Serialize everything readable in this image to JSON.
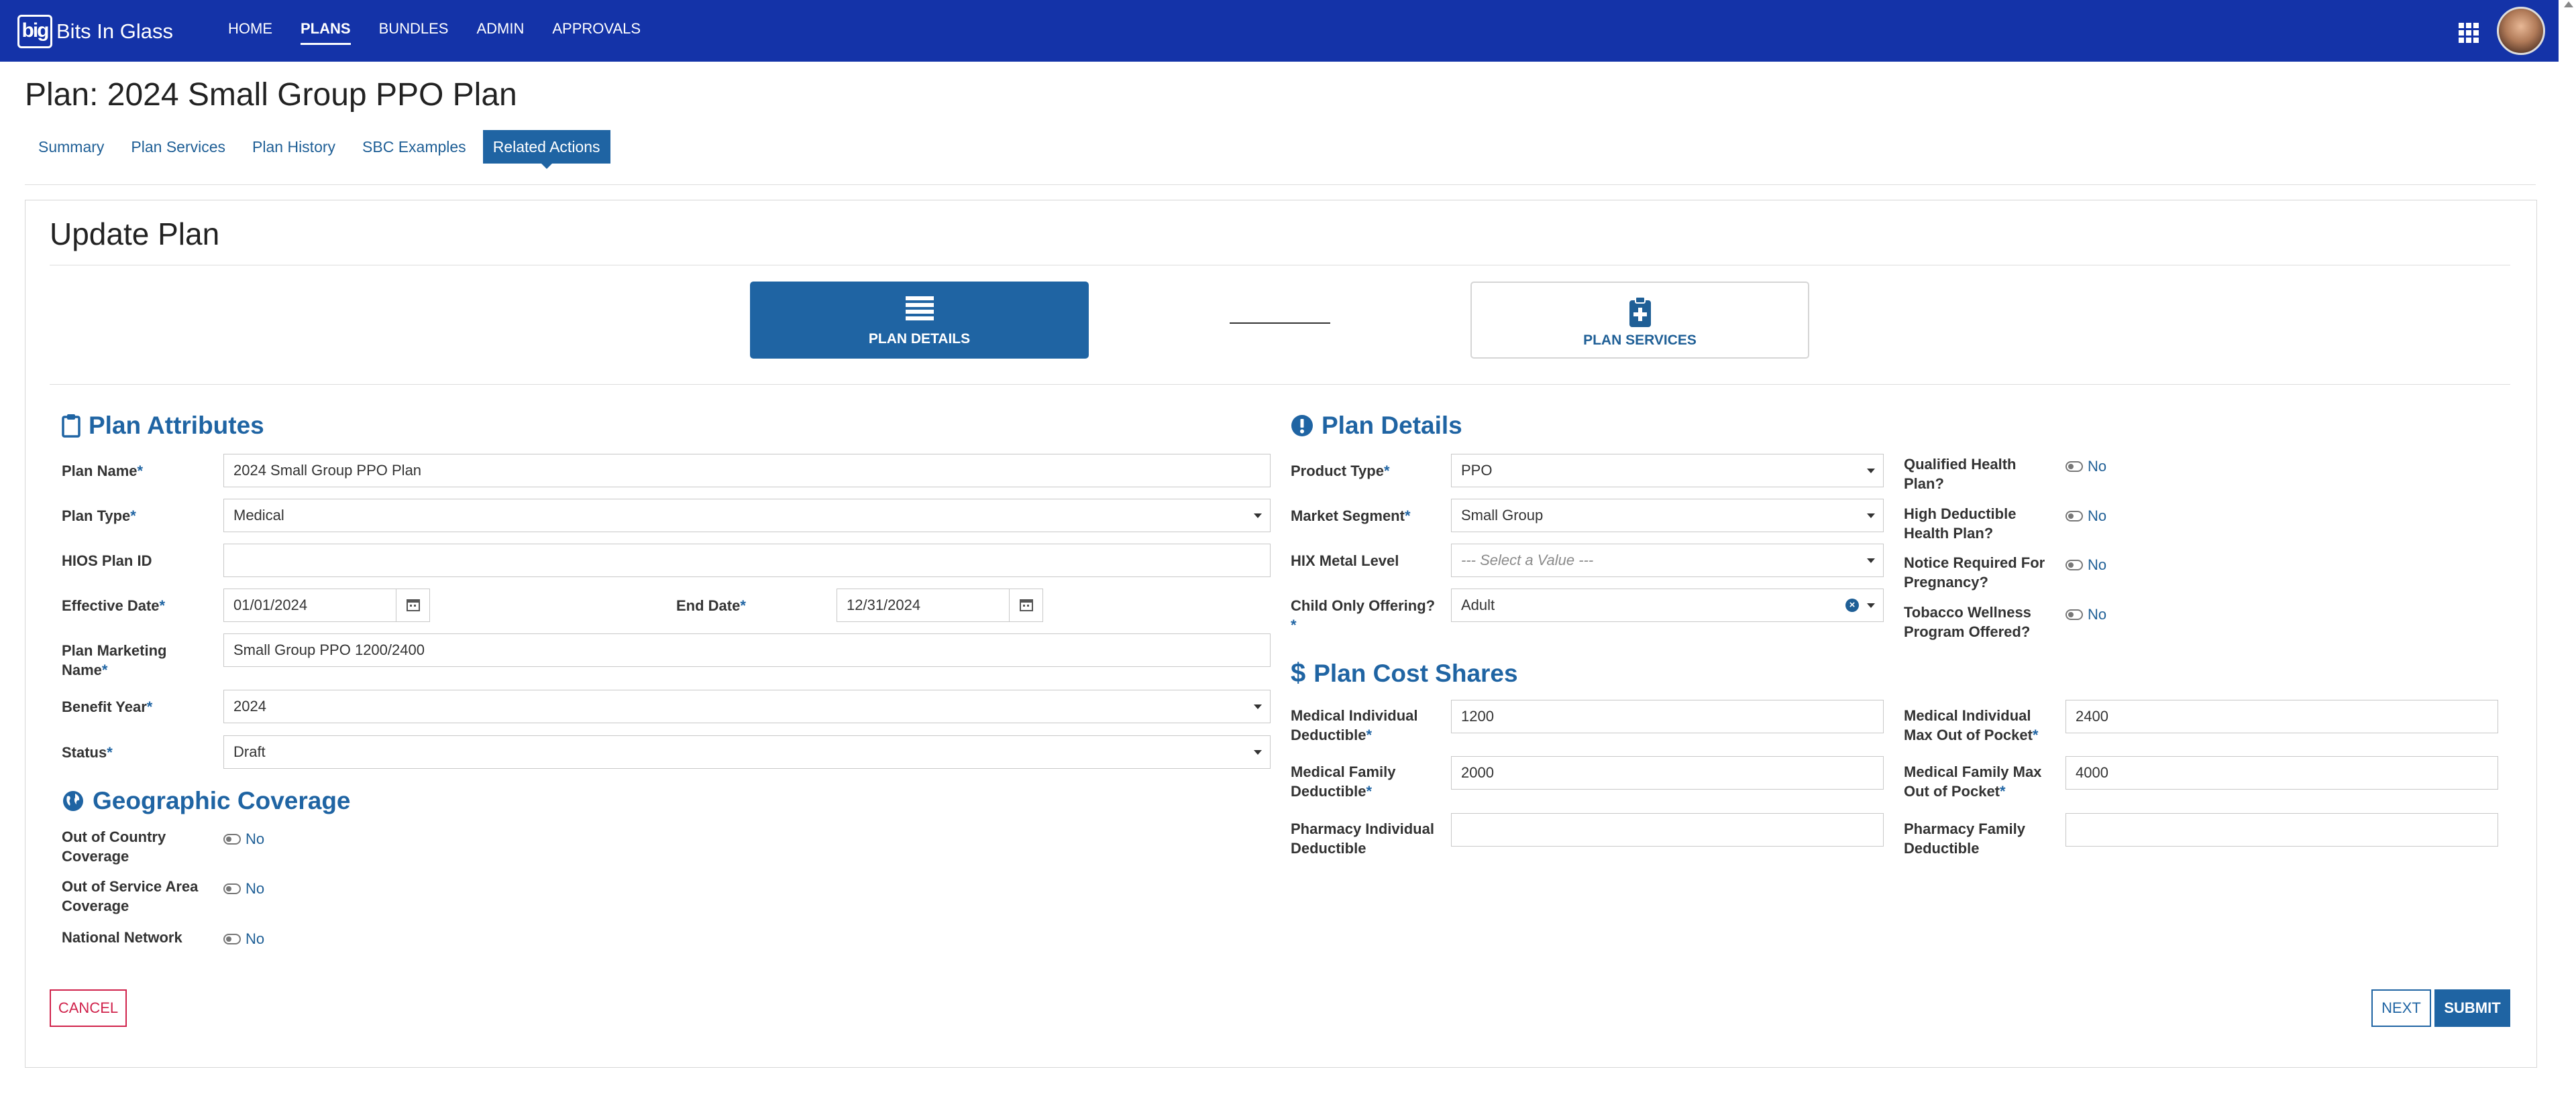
{
  "app": {
    "logo_mark": "big",
    "name": "Bits In Glass",
    "nav": [
      "HOME",
      "PLANS",
      "BUNDLES",
      "ADMIN",
      "APPROVALS"
    ],
    "active_nav": "PLANS"
  },
  "header": {
    "title": "Plan: 2024 Small Group PPO Plan",
    "tabs": [
      "Summary",
      "Plan Services",
      "Plan History",
      "SBC Examples",
      "Related Actions"
    ],
    "active_tab": "Related Actions"
  },
  "form": {
    "title": "Update Plan",
    "steps": [
      {
        "label": "PLAN DETAILS",
        "icon": "list-icon",
        "active": true
      },
      {
        "label": "PLAN SERVICES",
        "icon": "clipboard-plus-icon",
        "active": false
      }
    ]
  },
  "attributes": {
    "title": "Plan Attributes",
    "plan_name_label": "Plan Name",
    "plan_name_value": "2024 Small Group PPO Plan",
    "plan_type_label": "Plan Type",
    "plan_type_value": "Medical",
    "hios_label": "HIOS Plan ID",
    "hios_value": "",
    "effective_date_label": "Effective Date",
    "effective_date_value": "01/01/2024",
    "end_date_label": "End Date",
    "end_date_value": "12/31/2024",
    "marketing_name_label_1": "Plan Marketing",
    "marketing_name_label_2": "Name",
    "marketing_name_value": "Small Group PPO 1200/2400",
    "benefit_year_label": "Benefit Year",
    "benefit_year_value": "2024",
    "status_label": "Status",
    "status_value": "Draft"
  },
  "geo": {
    "title": "Geographic Coverage",
    "out_of_country_1": "Out of Country",
    "out_of_country_2": "Coverage",
    "out_of_country_value": "No",
    "out_of_area_1": "Out of Service Area",
    "out_of_area_2": "Coverage",
    "out_of_area_value": "No",
    "national_network": "National Network",
    "national_network_value": "No"
  },
  "details": {
    "title": "Plan Details",
    "product_type_label": "Product Type",
    "product_type_value": "PPO",
    "market_segment_label": "Market Segment",
    "market_segment_value": "Small Group",
    "hix_metal_label": "HIX Metal Level",
    "hix_metal_placeholder": "--- Select a Value ---",
    "child_only_label": "Child Only Offering?",
    "child_only_value": "Adult",
    "qhp_1": "Qualified Health",
    "qhp_2": "Plan?",
    "qhp_value": "No",
    "hdhp_1": "High Deductible",
    "hdhp_2": "Health Plan?",
    "hdhp_value": "No",
    "notice_1": "Notice Required For",
    "notice_2": "Pregnancy?",
    "notice_value": "No",
    "tobacco_1": "Tobacco Wellness",
    "tobacco_2": "Program Offered?",
    "tobacco_value": "No"
  },
  "cost_shares": {
    "title": "Plan Cost Shares",
    "med_ind_ded_1": "Medical Individual",
    "med_ind_ded_2": "Deductible",
    "med_ind_ded_value": "1200",
    "med_ind_oop_1": "Medical Individual",
    "med_ind_oop_2": "Max Out of Pocket",
    "med_ind_oop_value": "2400",
    "med_fam_ded_1": "Medical Family",
    "med_fam_ded_2": "Deductible",
    "med_fam_ded_value": "2000",
    "med_fam_oop_1": "Medical Family Max",
    "med_fam_oop_2": "Out of Pocket",
    "med_fam_oop_value": "4000",
    "rx_ind_ded_1": "Pharmacy Individual",
    "rx_ind_ded_2": "Deductible",
    "rx_ind_ded_value": "",
    "rx_fam_ded_1": "Pharmacy Family",
    "rx_fam_ded_2": "Deductible",
    "rx_fam_ded_value": ""
  },
  "buttons": {
    "cancel": "CANCEL",
    "next": "NEXT",
    "submit": "SUBMIT"
  },
  "required_marker": "*",
  "colors": {
    "topbar": "#1433a8",
    "accent": "#1f64a3",
    "cancel": "#d0224b"
  }
}
